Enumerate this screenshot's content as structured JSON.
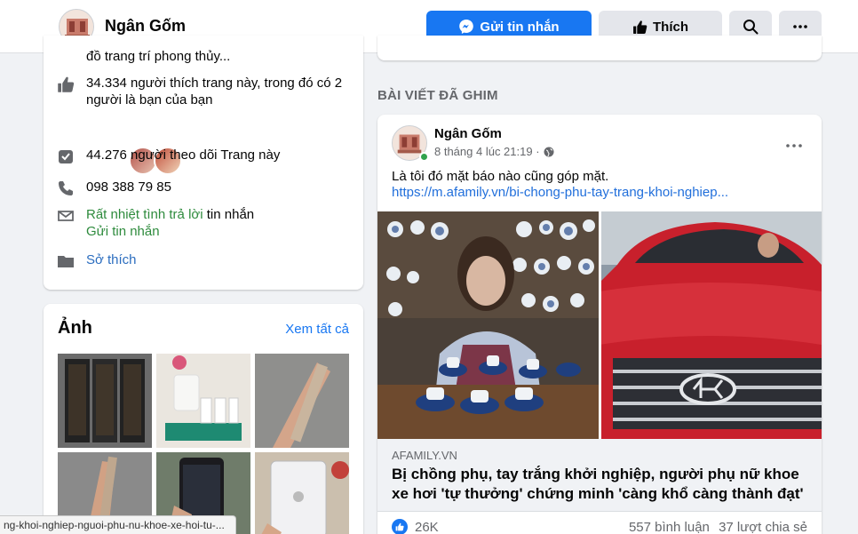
{
  "header": {
    "page_name": "Ngân Gốm",
    "message_button": "Gửi tin nhắn",
    "like_button": "Thích"
  },
  "intro": {
    "category_cut": "đồ trang trí phong thủy...",
    "likes_text_1": "34.334 người thích trang này, trong đó có 2",
    "likes_text_2": "người là bạn của bạn",
    "followers_text": "44.276 người theo dõi Trang này",
    "phone": "098 388 79 85",
    "response_highlight": "Rất nhiệt tình trả lời",
    "response_rest": " tin nhắn",
    "send_message_link": "Gửi tin nhắn",
    "interests": "Sở thích"
  },
  "photos": {
    "title": "Ảnh",
    "see_all": "Xem tất cả"
  },
  "pinned": {
    "section_label": "BÀI VIẾT ĐÃ GHIM",
    "author": "Ngân Gốm",
    "timestamp": "8 tháng 4 lúc 21:19 ·",
    "text": "Là tôi đó mặt báo nào cũng góp mặt.",
    "url": "https://m.afamily.vn/bi-chong-phu-tay-trang-khoi-nghiep...",
    "link_domain": "AFAMILY.VN",
    "link_title": "Bị chồng phụ, tay trắng khởi nghiệp, người phụ nữ khoe xe hơi 'tự thưởng' chứng minh 'càng khổ càng thành đạt'",
    "like_count": "26K",
    "comments": "557 bình luận",
    "shares": "37 lượt chia sẻ"
  },
  "status_bar": {
    "url": "ng-khoi-nghiep-nguoi-phu-nu-khoe-xe-hoi-tu-..."
  },
  "colors": {
    "brand_blue": "#1877f2",
    "online_green": "#31a24c",
    "response_green": "#2e8b3d",
    "background": "#f0f2f5"
  }
}
